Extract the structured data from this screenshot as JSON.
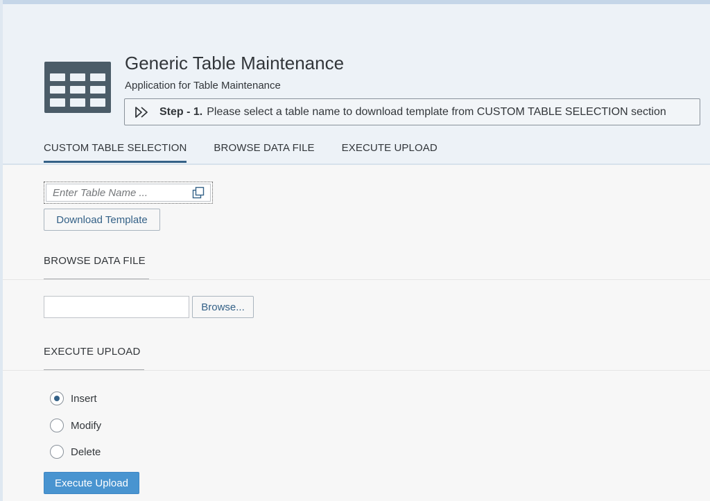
{
  "header": {
    "title": "Generic Table Maintenance",
    "subtitle": "Application for Table Maintenance",
    "step": {
      "prefix": "Step - 1.",
      "text": "Please select a table name to download template from CUSTOM TABLE SELECTION section"
    },
    "icon": "table-icon"
  },
  "tabs": [
    {
      "label": "CUSTOM TABLE SELECTION",
      "active": true
    },
    {
      "label": "BROWSE DATA FILE",
      "active": false
    },
    {
      "label": "EXECUTE UPLOAD",
      "active": false
    }
  ],
  "custom_table": {
    "input_placeholder": "Enter Table Name ...",
    "input_value": "",
    "value_help_icon": "value-help-icon",
    "download_label": "Download Template"
  },
  "browse": {
    "section_title": "BROWSE DATA FILE",
    "file_value": "",
    "browse_label": "Browse..."
  },
  "execute": {
    "section_title": "EXECUTE UPLOAD",
    "options": [
      {
        "label": "Insert",
        "checked": true
      },
      {
        "label": "Modify",
        "checked": false
      },
      {
        "label": "Delete",
        "checked": false
      }
    ],
    "button_label": "Execute Upload"
  },
  "colors": {
    "accent": "#346187",
    "primary_button": "#4994d0",
    "header_bg": "#edf2f7",
    "icon": "#4b5c68"
  }
}
